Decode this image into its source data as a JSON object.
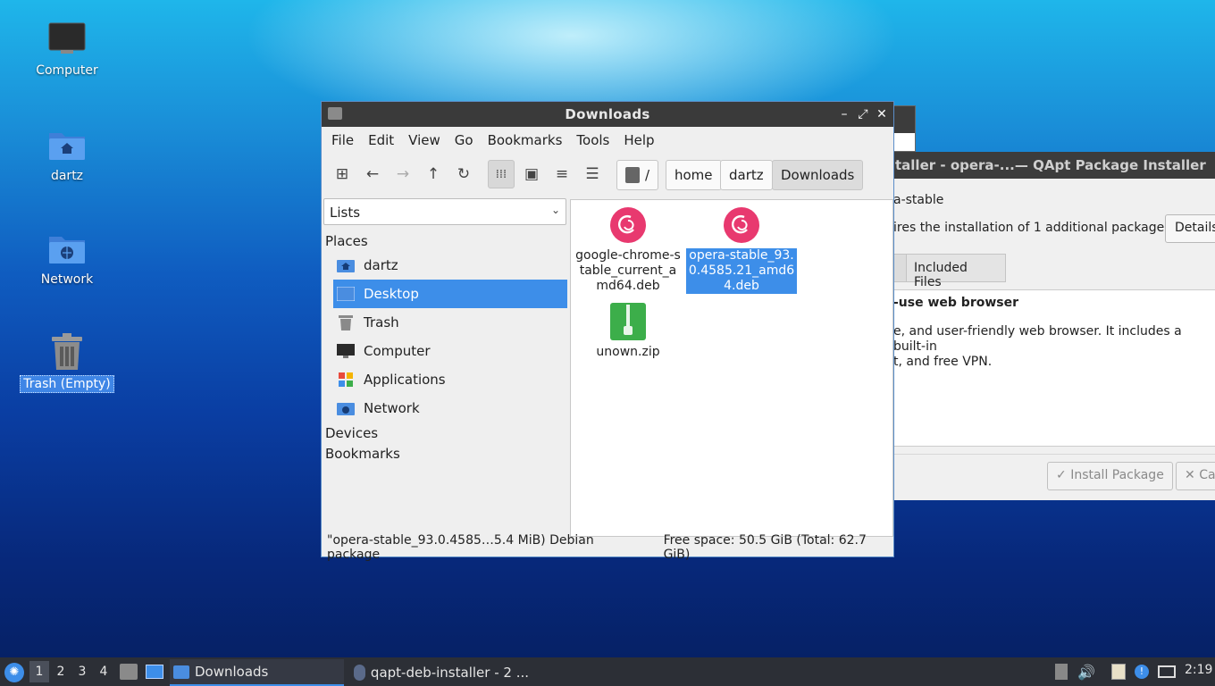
{
  "desktop": {
    "icons": [
      {
        "label": "Computer"
      },
      {
        "label": "dartz"
      },
      {
        "label": "Network"
      },
      {
        "label": "Trash (Empty)"
      }
    ]
  },
  "qapt": {
    "title": "taller - opera-...— QApt Package Installer",
    "package": "a-stable",
    "requires": "ires the installation of 1 additional package.",
    "details_button": "Details",
    "tab_included": "Included Files",
    "desc_heading": "-use web browser",
    "desc_line1": "e, and user-friendly web browser. It includes a built-in",
    "desc_line2": "t, and free VPN.",
    "install_button": "Install Package",
    "cancel_button": "Ca"
  },
  "file_manager": {
    "title": "Downloads",
    "menu": [
      "File",
      "Edit",
      "View",
      "Go",
      "Bookmarks",
      "Tools",
      "Help"
    ],
    "breadcrumb": [
      "/",
      "home",
      "dartz",
      "Downloads"
    ],
    "side_select": "Lists",
    "places_header": "Places",
    "places": [
      "dartz",
      "Desktop",
      "Trash",
      "Computer",
      "Applications",
      "Network"
    ],
    "devices_header": "Devices",
    "bookmarks_header": "Bookmarks",
    "files": [
      {
        "name": "google-chrome-stable_current_amd64.deb",
        "icon": "debian-package-icon"
      },
      {
        "name": "opera-stable_93.0.4585.21_amd64.deb",
        "icon": "debian-package-icon"
      },
      {
        "name": "unown.zip",
        "icon": "zip-archive-icon"
      }
    ],
    "status_selection": "\"opera-stable_93.0.4585…5.4 MiB) Debian package",
    "status_space": "Free space: 50.5 GiB (Total: 62.7 GiB)"
  },
  "taskbar": {
    "workspaces": [
      "1",
      "2",
      "3",
      "4"
    ],
    "tasks": [
      {
        "label": "Downloads"
      },
      {
        "label": "qapt-deb-installer - 2 ..."
      }
    ],
    "clock": "2:19"
  },
  "colors": {
    "accent": "#3d8ee9",
    "debian": "#e8396f",
    "zip": "#3cae4a"
  }
}
